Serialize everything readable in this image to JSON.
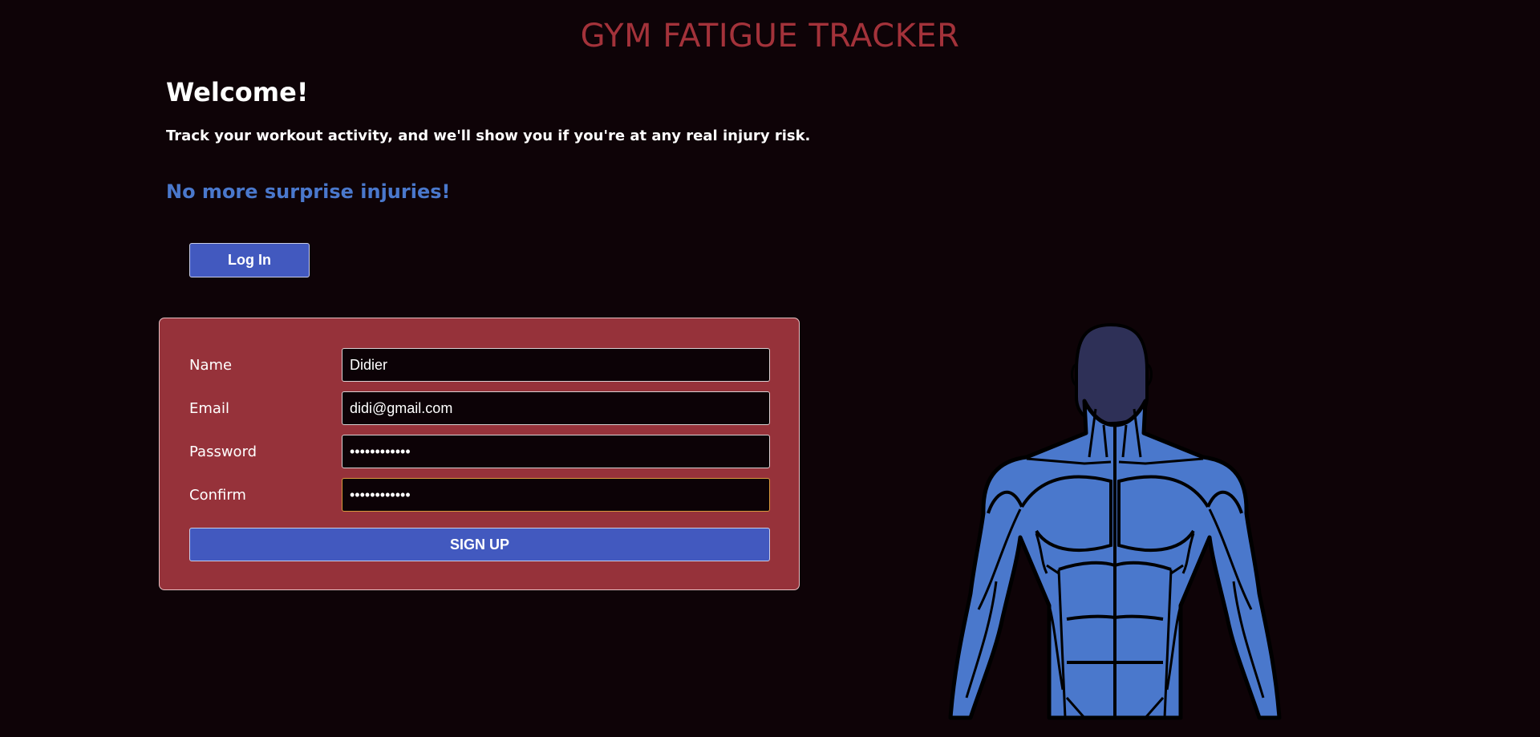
{
  "app": {
    "title": "GYM FATIGUE TRACKER"
  },
  "intro": {
    "welcome": "Welcome!",
    "subtitle": "Track your workout activity, and we'll show you if you're at any real injury risk.",
    "tagline": "No more surprise injuries!"
  },
  "login_button": {
    "label": "Log In"
  },
  "signup_form": {
    "fields": [
      {
        "label": "Name",
        "value": "Didier",
        "type": "text"
      },
      {
        "label": "Email",
        "value": "didi@gmail.com",
        "type": "text"
      },
      {
        "label": "Password",
        "value": "••••••••••••",
        "type": "password"
      },
      {
        "label": "Confirm",
        "value": "••••••••••••",
        "type": "password"
      }
    ],
    "submit_label": "SIGN UP"
  },
  "illustration": {
    "icon": "muscular-torso-icon",
    "colors": {
      "body": "#4a78cc",
      "head": "#2e3057",
      "outline": "#000000"
    }
  },
  "colors": {
    "background": "#0e0307",
    "title": "#a3323a",
    "accent": "#4259bf",
    "tagline": "#4a78cc",
    "card": "#96323a"
  }
}
